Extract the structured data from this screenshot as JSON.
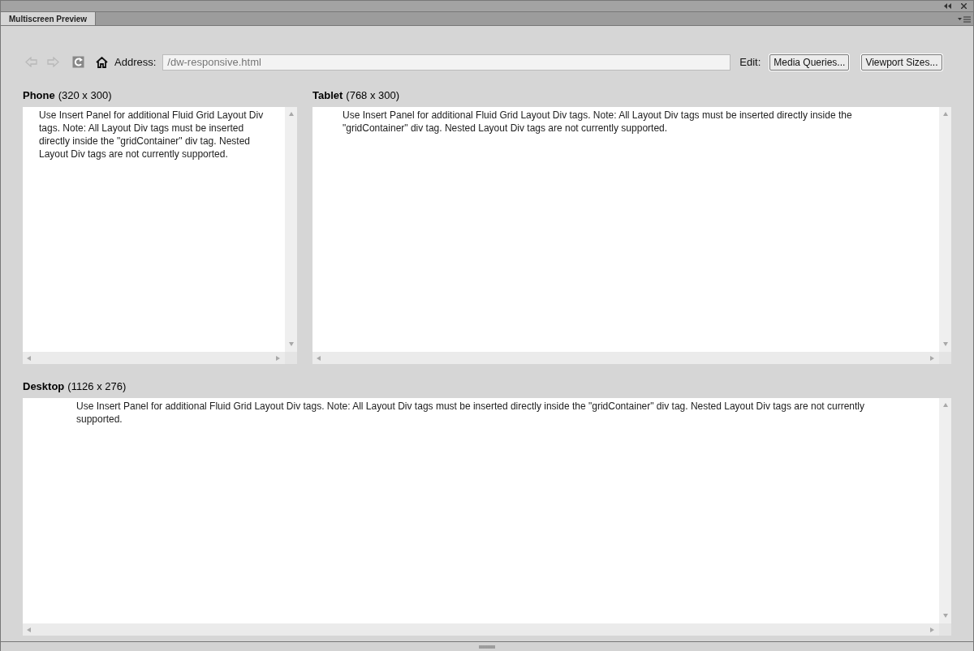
{
  "tab": {
    "title": "Multiscreen Preview"
  },
  "toolbar": {
    "back": {
      "disabled": true
    },
    "forward": {
      "disabled": true
    },
    "address_label": "Address:",
    "address_value": "/dw-responsive.html",
    "edit_label": "Edit:",
    "buttons": [
      "Media Queries...",
      "Viewport Sizes..."
    ]
  },
  "previews": [
    {
      "name": "Phone",
      "size": "(320 x 300)",
      "text": "Use Insert Panel for additional Fluid Grid Layout Div tags. Note: All Layout Div tags must be inserted directly inside the \"gridContainer\" div tag. Nested Layout Div tags are not currently supported."
    },
    {
      "name": "Tablet",
      "size": "(768 x 300)",
      "text": "Use Insert Panel for additional Fluid Grid Layout Div tags. Note: All Layout Div tags must be inserted directly inside the \"gridContainer\" div tag. Nested Layout Div tags are not currently supported."
    },
    {
      "name": "Desktop",
      "size": "(1126 x 276)",
      "text": "Use Insert Panel for additional Fluid Grid Layout Div tags. Note: All Layout Div tags must be inserted directly inside the \"gridContainer\" div tag. Nested Layout Div tags are not currently supported."
    }
  ]
}
